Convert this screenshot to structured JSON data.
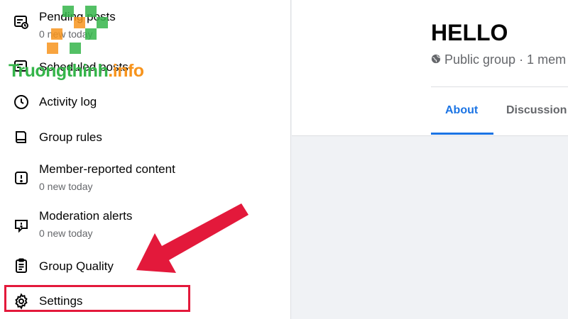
{
  "sidebar": {
    "items": [
      {
        "label": "Pending posts",
        "sub": "0 new today",
        "icon": "pending-posts-icon"
      },
      {
        "label": "Scheduled posts",
        "icon": "scheduled-posts-icon"
      },
      {
        "label": "Activity log",
        "icon": "clock-icon"
      },
      {
        "label": "Group rules",
        "icon": "book-icon"
      },
      {
        "label": "Member-reported content",
        "sub": "0 new today",
        "icon": "alert-icon"
      },
      {
        "label": "Moderation alerts",
        "sub": "0 new today",
        "icon": "moderation-alert-icon"
      },
      {
        "label": "Group Quality",
        "icon": "clipboard-icon"
      },
      {
        "label": "Settings",
        "icon": "gear-icon"
      }
    ]
  },
  "watermark": {
    "part1": "Truongthinh",
    "part2": ".info"
  },
  "group": {
    "title": "HELLO",
    "meta": "Public group · 1 mem",
    "tabs": [
      {
        "label": "About",
        "active": true
      },
      {
        "label": "Discussion"
      }
    ]
  },
  "colors": {
    "highlight": "#e3193b",
    "arrow": "#e3193b",
    "accent": "#1b74e4",
    "watermark_green": "#35b54a",
    "watermark_orange": "#f7941d"
  }
}
